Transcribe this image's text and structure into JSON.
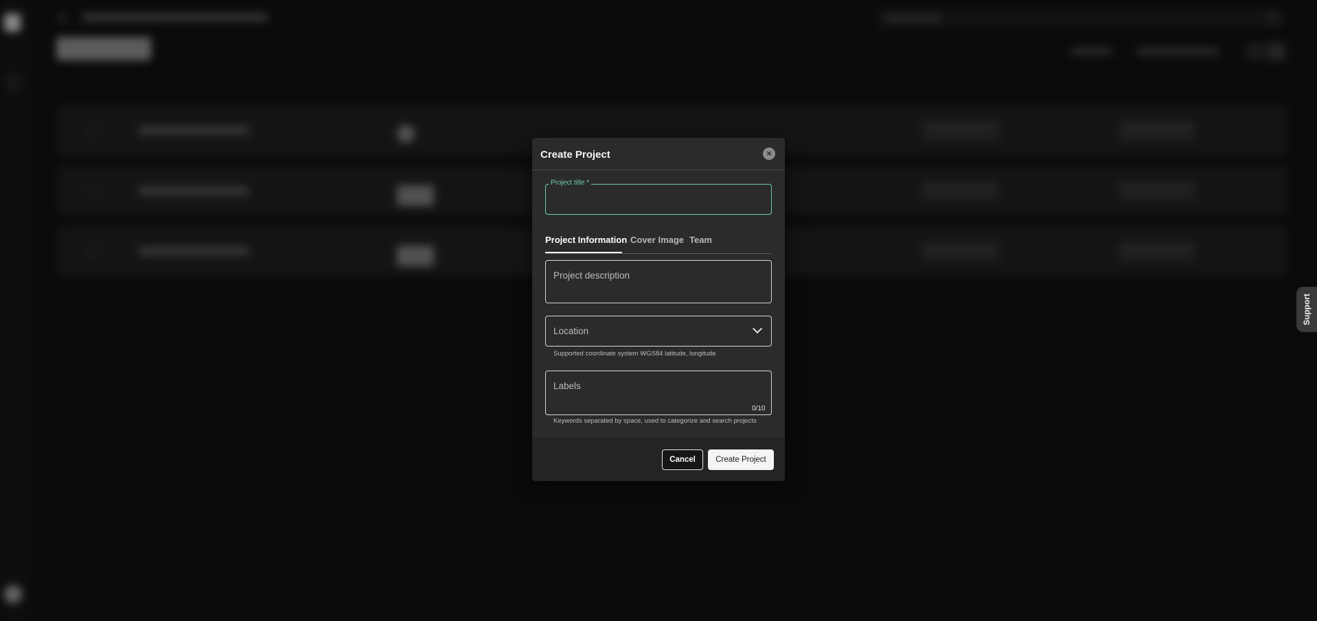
{
  "dialog": {
    "title": "Create Project",
    "close_icon": "close-icon",
    "project_title": {
      "label": "Project title *",
      "value": ""
    },
    "tabs": [
      {
        "label": "Project Information",
        "active": true
      },
      {
        "label": "Cover Image",
        "active": false
      },
      {
        "label": "Team",
        "active": false
      }
    ],
    "description": {
      "placeholder": "Project description"
    },
    "location": {
      "placeholder": "Location",
      "helper": "Supported coordinate system WGS84 latitude, longitude"
    },
    "labels": {
      "placeholder": "Labels",
      "counter": "0/10",
      "helper": "Keywords separated by space, used to categorize and search projects"
    },
    "buttons": {
      "cancel": "Cancel",
      "create": "Create Project"
    }
  },
  "support": {
    "label": "Support"
  },
  "colors": {
    "accent": "#6fcfb1",
    "background": "#111111",
    "dialog": "#2b2b2b"
  }
}
